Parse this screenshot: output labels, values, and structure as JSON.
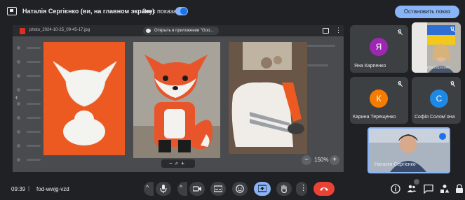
{
  "top_bar": {
    "presenter_title": "Наталія Сергієнко (ви, на главном экране)",
    "sound_label": "Звук показа",
    "stop_button": "Остановить показ"
  },
  "viewer": {
    "file_name": "photo_2024-10-25_09-45-17.jpg",
    "open_with": "Открыть в приложении \"Goo...",
    "zoom_level": "150%",
    "zoom_out": "−",
    "zoom_in": "+"
  },
  "participants": [
    {
      "initial": "Я",
      "name": "Яна Карпенко",
      "color": "#9c27b0"
    },
    {
      "initial": "К",
      "name": "Карина Терещенко",
      "color": "#f57c00"
    },
    {
      "initial": "С",
      "name": "Софія Солом`яна",
      "color": "#1e88e5"
    }
  ],
  "self_tile": {
    "name": "Наталія Сергієнко"
  },
  "photo_tile": {
    "caption": "Наталія Сергієнко"
  },
  "bottom_bar": {
    "time": "09:39",
    "separator": "|",
    "meeting_code": "fod-wwjg-vzd"
  },
  "icons": {
    "mic": "mic-icon",
    "camera": "camera-icon",
    "captions": "captions-icon",
    "emoji": "emoji-icon",
    "present": "present-screen-icon",
    "hand": "raise-hand-icon",
    "more": "more-icon",
    "hangup": "hangup-icon",
    "info": "info-icon",
    "people": "people-icon",
    "chat": "chat-icon",
    "activities": "activities-icon",
    "lock": "lock-icon"
  },
  "colors": {
    "accent": "#8ab4f8",
    "hangup": "#ea4335",
    "fox_orange": "#ec5a22"
  }
}
